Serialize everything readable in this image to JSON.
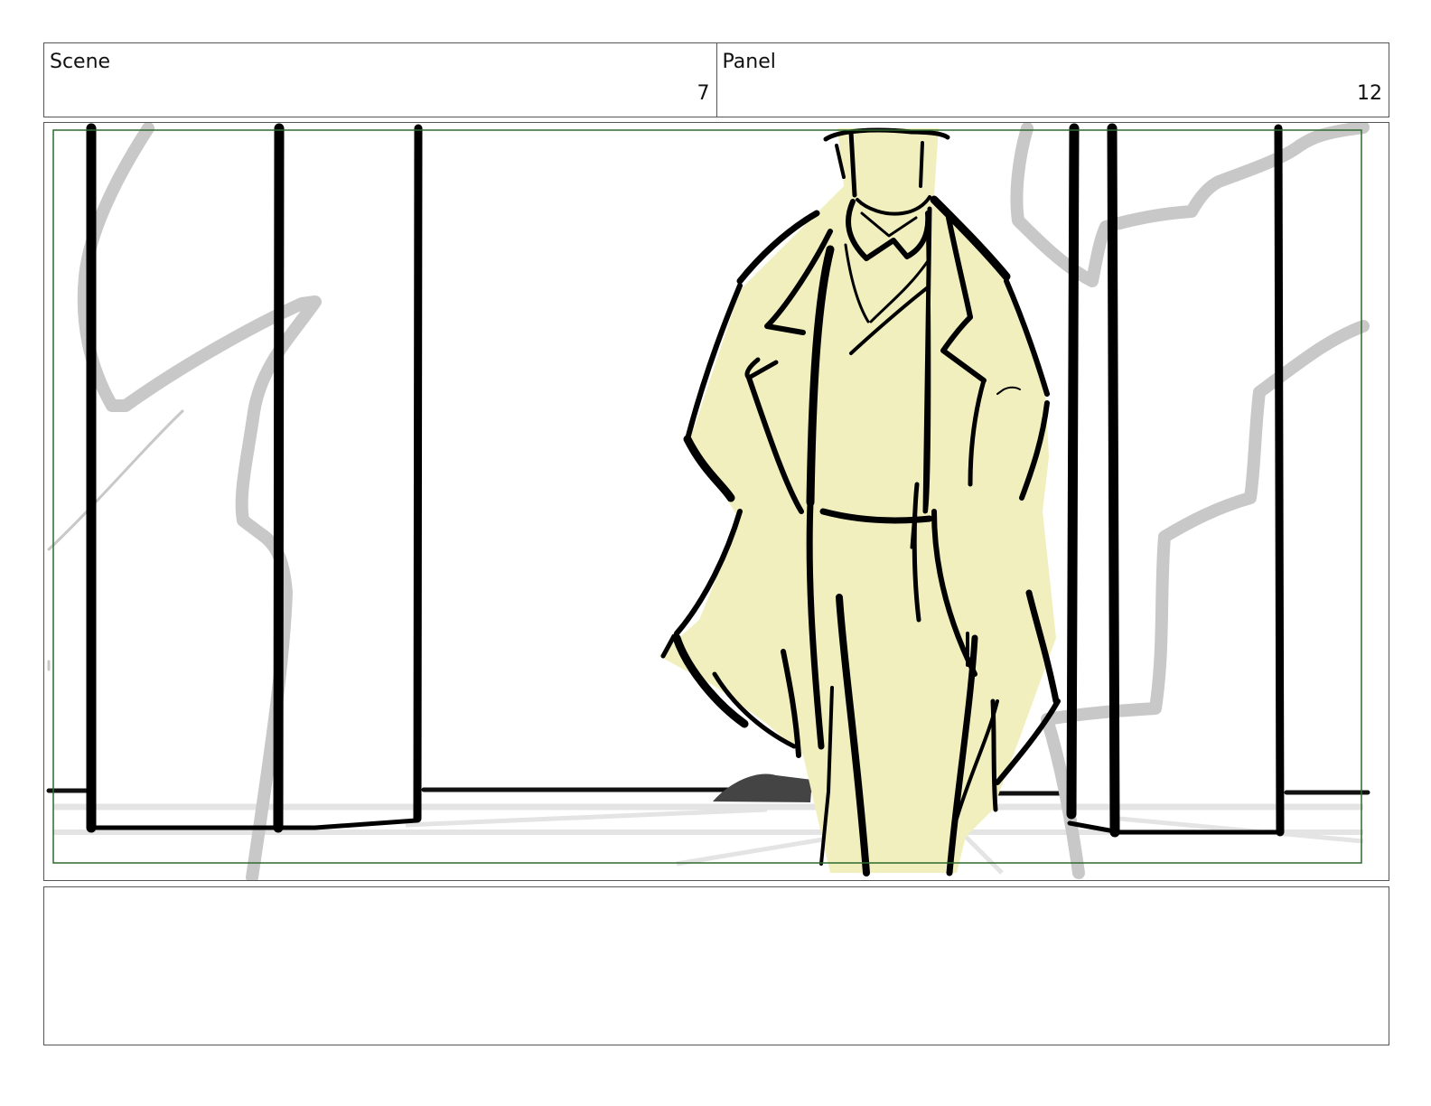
{
  "scene": {
    "label": "Scene",
    "value": "7"
  },
  "panel": {
    "label": "Panel",
    "value": "12"
  },
  "notes": {
    "text": ""
  },
  "colors": {
    "border": "#555555",
    "safe_frame": "#2d6a2d",
    "ink": "#000000",
    "coat_fill": "#f1efbe",
    "reflection": "#c8c8c8"
  }
}
